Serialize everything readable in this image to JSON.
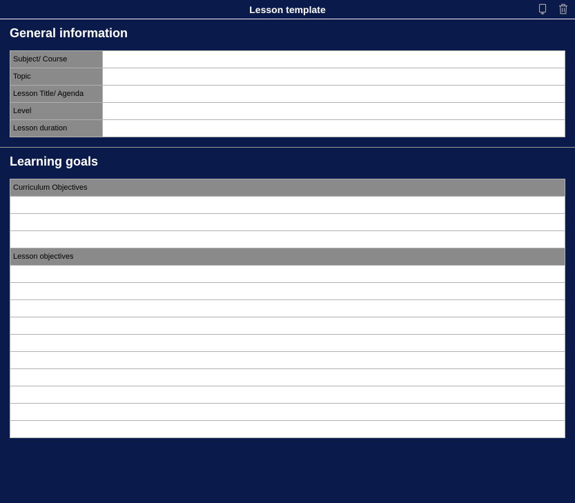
{
  "header": {
    "title": "Lesson template"
  },
  "sections": {
    "general_info": {
      "title": "General information",
      "rows": [
        {
          "label": "Subject/ Course",
          "value": ""
        },
        {
          "label": "Topic",
          "value": ""
        },
        {
          "label": "Lesson Title/ Agenda",
          "value": ""
        },
        {
          "label": "Level",
          "value": ""
        },
        {
          "label": "Lesson duration",
          "value": ""
        }
      ]
    },
    "learning_goals": {
      "title": "Learning goals",
      "curriculum_header": "Curriculum Objectives",
      "curriculum_rows": [
        "",
        "",
        ""
      ],
      "lesson_header": "Lesson objectives",
      "lesson_rows": [
        "",
        "",
        "",
        "",
        "",
        "",
        "",
        "",
        "",
        ""
      ]
    }
  }
}
